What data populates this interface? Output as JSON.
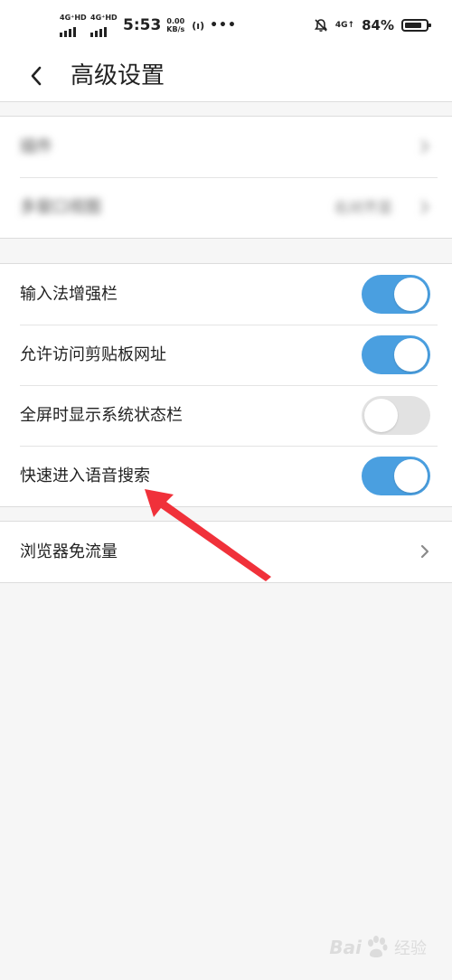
{
  "status_bar": {
    "net1": "4G⁺HD",
    "net2": "4G⁺HD",
    "time": "5:53",
    "speed_value": "0.00",
    "speed_unit": "KB/s",
    "wifi_glyph": "(ı)",
    "more": "•••",
    "net_4g": "4G↑",
    "battery": "84%",
    "battery_level": 0.84
  },
  "header": {
    "title": "高级设置"
  },
  "group1": {
    "items": [
      {
        "label": "插件"
      },
      {
        "label": "多窗口视图",
        "value": "右对齐显"
      }
    ]
  },
  "group2": {
    "items": [
      {
        "label": "输入法增强栏",
        "checked": true
      },
      {
        "label": "允许访问剪贴板网址",
        "checked": true
      },
      {
        "label": "全屏时显示系统状态栏",
        "checked": false
      },
      {
        "label": "快速进入语音搜索",
        "checked": true
      }
    ]
  },
  "group3": {
    "items": [
      {
        "label": "浏览器免流量"
      }
    ]
  },
  "watermark": {
    "brand_left": "Bai",
    "brand_right": "经验"
  },
  "colors": {
    "toggle_on": "#4a9fe0",
    "toggle_off": "#e2e2e2",
    "arrow": "#f0313a"
  }
}
